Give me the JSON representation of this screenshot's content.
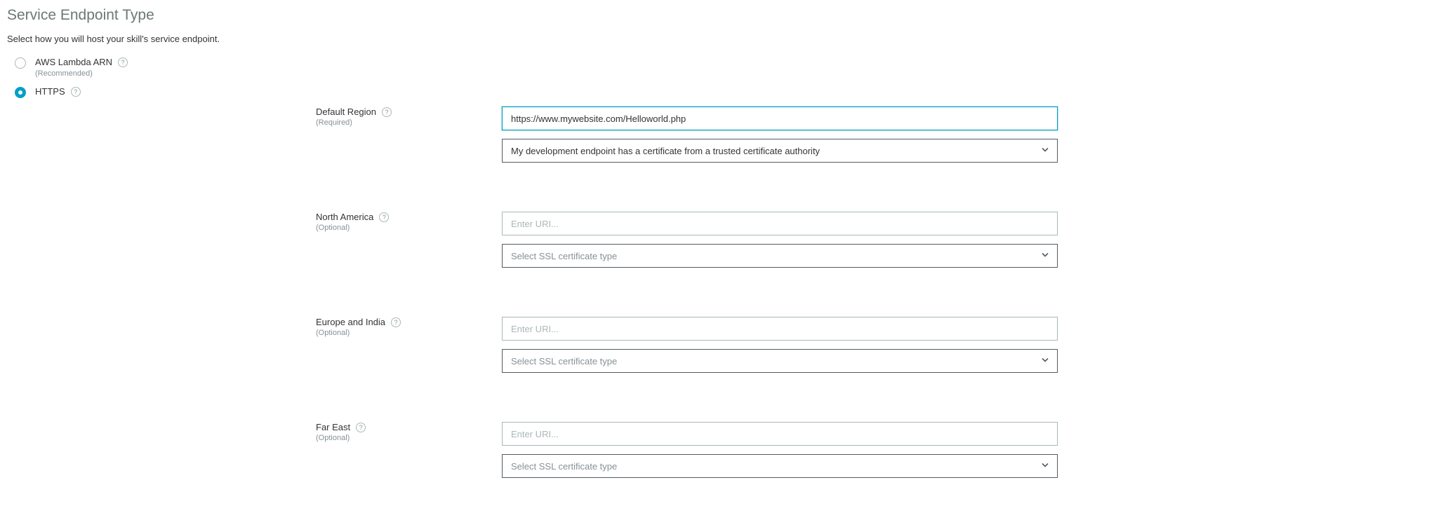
{
  "header": {
    "title": "Service Endpoint Type",
    "subtitle": "Select how you will host your skill's service endpoint."
  },
  "options": {
    "lambda": {
      "label": "AWS Lambda ARN",
      "sub": "(Recommended)"
    },
    "https": {
      "label": "HTTPS"
    }
  },
  "regions": {
    "default": {
      "label": "Default Region",
      "sub": "(Required)",
      "uri_value": "https://www.mywebsite.com/Helloworld.php",
      "ssl_selected": "My development endpoint has a certificate from a trusted certificate authority"
    },
    "na": {
      "label": "North America",
      "sub": "(Optional)",
      "uri_placeholder": "Enter URI...",
      "ssl_placeholder": "Select SSL certificate type"
    },
    "eu": {
      "label": "Europe and India",
      "sub": "(Optional)",
      "uri_placeholder": "Enter URI...",
      "ssl_placeholder": "Select SSL certificate type"
    },
    "fe": {
      "label": "Far East",
      "sub": "(Optional)",
      "uri_placeholder": "Enter URI...",
      "ssl_placeholder": "Select SSL certificate type"
    }
  }
}
